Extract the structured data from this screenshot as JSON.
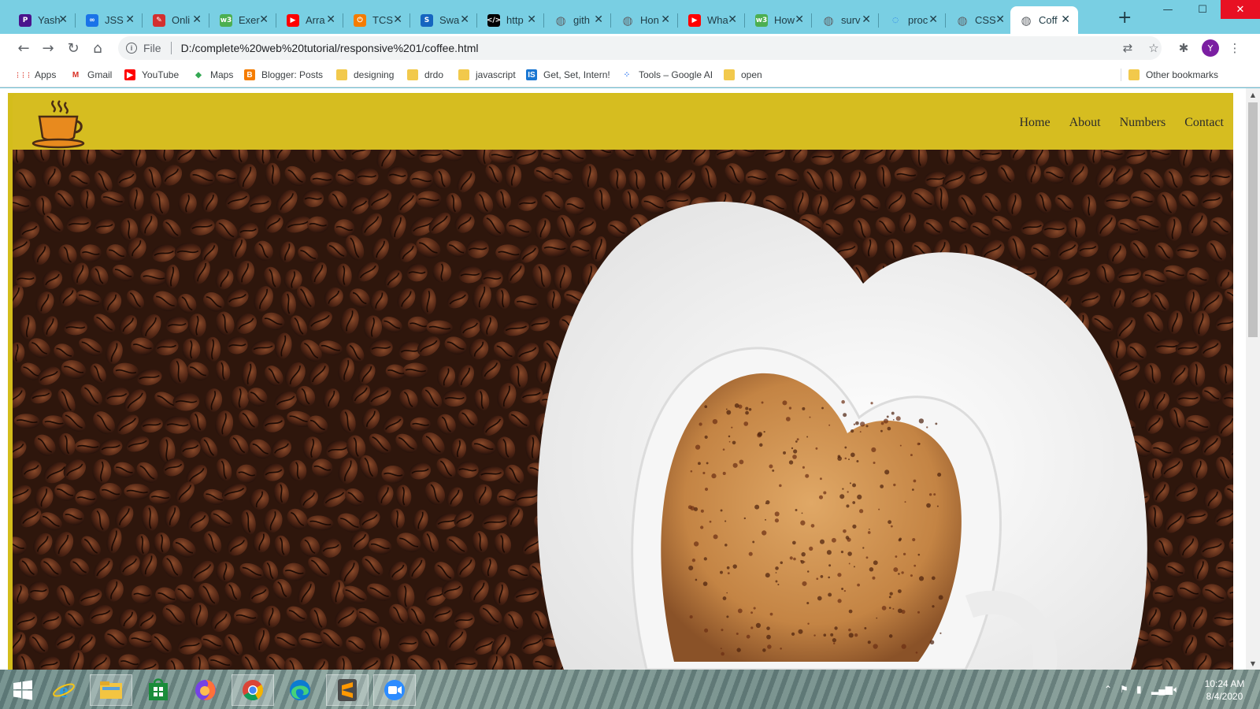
{
  "browser": {
    "tabs": [
      {
        "title": "Yash",
        "icon": "p-icon",
        "color": "#4a148c"
      },
      {
        "title": "JSS",
        "icon": "infinity-icon",
        "color": "#1a73e8"
      },
      {
        "title": "Onli",
        "icon": "pen-icon",
        "color": "#d32f2f"
      },
      {
        "title": "Exer",
        "icon": "w3-icon",
        "color": "#4caf50"
      },
      {
        "title": "Arra",
        "icon": "youtube-icon",
        "color": "#ff0000"
      },
      {
        "title": "TCS",
        "icon": "power-icon",
        "color": "#f57c00"
      },
      {
        "title": "Swa",
        "icon": "s-icon",
        "color": "#1565c0"
      },
      {
        "title": "http",
        "icon": "code-icon",
        "color": "#000000"
      },
      {
        "title": "gith",
        "icon": "globe-icon",
        "color": "#5f6368"
      },
      {
        "title": "Hon",
        "icon": "globe-icon",
        "color": "#5f6368"
      },
      {
        "title": "Wha",
        "icon": "youtube-icon",
        "color": "#ff0000"
      },
      {
        "title": "How",
        "icon": "w3-icon",
        "color": "#4caf50"
      },
      {
        "title": "surv",
        "icon": "globe-icon",
        "color": "#5f6368"
      },
      {
        "title": "proc",
        "icon": "loading-icon",
        "color": "#1a73e8"
      },
      {
        "title": "CSS",
        "icon": "globe-icon",
        "color": "#5f6368"
      },
      {
        "title": "Coff",
        "icon": "globe-icon",
        "color": "#5f6368",
        "active": true
      }
    ],
    "scheme_label": "File",
    "url": "D:/complete%20web%20tutorial/responsive%201/coffee.html",
    "profile_initial": "Y"
  },
  "bookmarks": [
    {
      "label": "Apps",
      "icon": "apps-grid-icon"
    },
    {
      "label": "Gmail",
      "icon": "gmail-icon"
    },
    {
      "label": "YouTube",
      "icon": "youtube-icon"
    },
    {
      "label": "Maps",
      "icon": "maps-icon"
    },
    {
      "label": "Blogger: Posts",
      "icon": "blogger-icon"
    },
    {
      "label": "designing",
      "icon": "folder-icon"
    },
    {
      "label": "drdo",
      "icon": "folder-icon"
    },
    {
      "label": "javascript",
      "icon": "folder-icon"
    },
    {
      "label": "Get, Set, Intern!",
      "icon": "is-icon"
    },
    {
      "label": "Tools – Google AI",
      "icon": "google-ai-icon"
    },
    {
      "label": "open",
      "icon": "folder-icon"
    },
    {
      "label": "Other bookmarks",
      "icon": "folder-icon"
    }
  ],
  "site": {
    "nav": [
      "Home",
      "About",
      "Numbers",
      "Contact"
    ],
    "colors": {
      "navbar": "#d6bd20",
      "accent": "#d4bd1b"
    }
  },
  "taskbar": {
    "time": "10:24 AM",
    "date": "8/4/2020"
  }
}
